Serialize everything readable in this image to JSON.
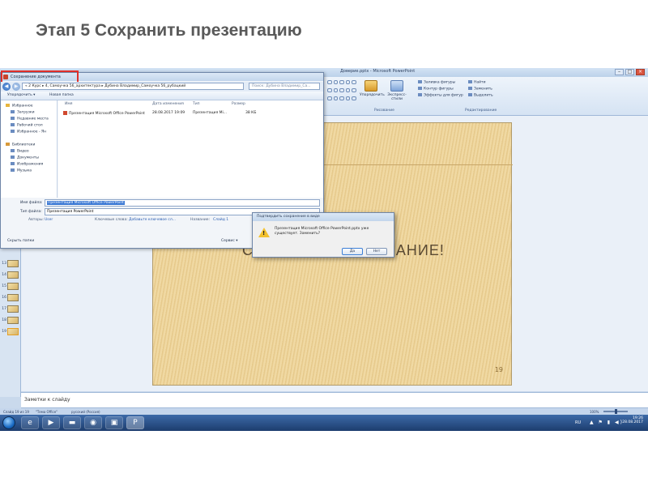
{
  "slide_title": "Этап 5 Сохранить презентацию",
  "powerpoint": {
    "window_title": "Доверие.pptx - Microsoft PowerPoint",
    "ribbon": {
      "arrange": "Упорядочить",
      "quick_styles": "Экспресс-стили",
      "shape_fill": "Заливка фигуры",
      "shape_outline": "Контур фигуры",
      "shape_effects": "Эффекты для фигур",
      "find": "Найти",
      "replace": "Заменить",
      "select": "Выделить",
      "group_drawing": "Рисование",
      "group_editing": "Редактирование"
    },
    "thumbnails": [
      "13",
      "14",
      "15",
      "16",
      "17",
      "18",
      "19"
    ],
    "slide": {
      "heading": "СПАСИБО ЗА ВНИМАНИЕ!",
      "number": "19"
    },
    "notes_placeholder": "Заметки к слайду",
    "status": {
      "slide_info": "Слайд 19 из 19",
      "theme": "\"Тема Office\"",
      "language": "русский (Россия)",
      "zoom": "100%"
    }
  },
  "save_dialog": {
    "title": "Сохранение документа",
    "address": "« 2 Курс ▸ 4, Самоучка 56_архитектура ▸ Дубина Владимир_Самоучка 56_рубацкий",
    "search_placeholder": "Поиск: Дубина Владимир_Са...",
    "organize": "Упорядочить ▾",
    "new_folder": "Новая папка",
    "nav": {
      "favorites": "Избранное",
      "downloads": "Загрузки",
      "recent": "Недавние места",
      "desktop": "Рабочий стол",
      "fav_ya": "Избранное - Ян",
      "libraries": "Библиотеки",
      "video": "Видео",
      "documents": "Документы",
      "images": "Изображения",
      "music": "Музыка"
    },
    "columns": {
      "name": "Имя",
      "date": "Дата изменения",
      "type": "Тип",
      "size": "Размер"
    },
    "files": [
      {
        "name": "Презентация Microsoft Office PowerPoint",
        "date": "28.08.2017 19:09",
        "type": "Презентация Mi...",
        "size": "38 КБ"
      }
    ],
    "file_name_label": "Имя файла:",
    "file_name_value": "Презентация Microsoft Office PowerPoint",
    "file_type_label": "Тип файла:",
    "file_type_value": "Презентация PowerPoint",
    "authors_label": "Авторы:",
    "authors_value": "User",
    "keywords_label": "Ключевые слова:",
    "keywords_value": "Добавьте ключевое сл...",
    "title_label": "Название:",
    "title_value": "Слайд 1",
    "hide_folders": "Скрыть папки",
    "service": "Сервис ▾"
  },
  "confirm_dialog": {
    "title": "Подтвердить сохранение в виде",
    "message": "Презентация Microsoft Office PowerPoint.pptx уже существует. Заменить?",
    "yes": "Да",
    "no": "Нет"
  },
  "taskbar": {
    "language": "RU",
    "time": "19:26",
    "date": "28.08.2017"
  },
  "colors": {
    "highlight_box": "#e0302a",
    "selection": "#3a78d4"
  }
}
